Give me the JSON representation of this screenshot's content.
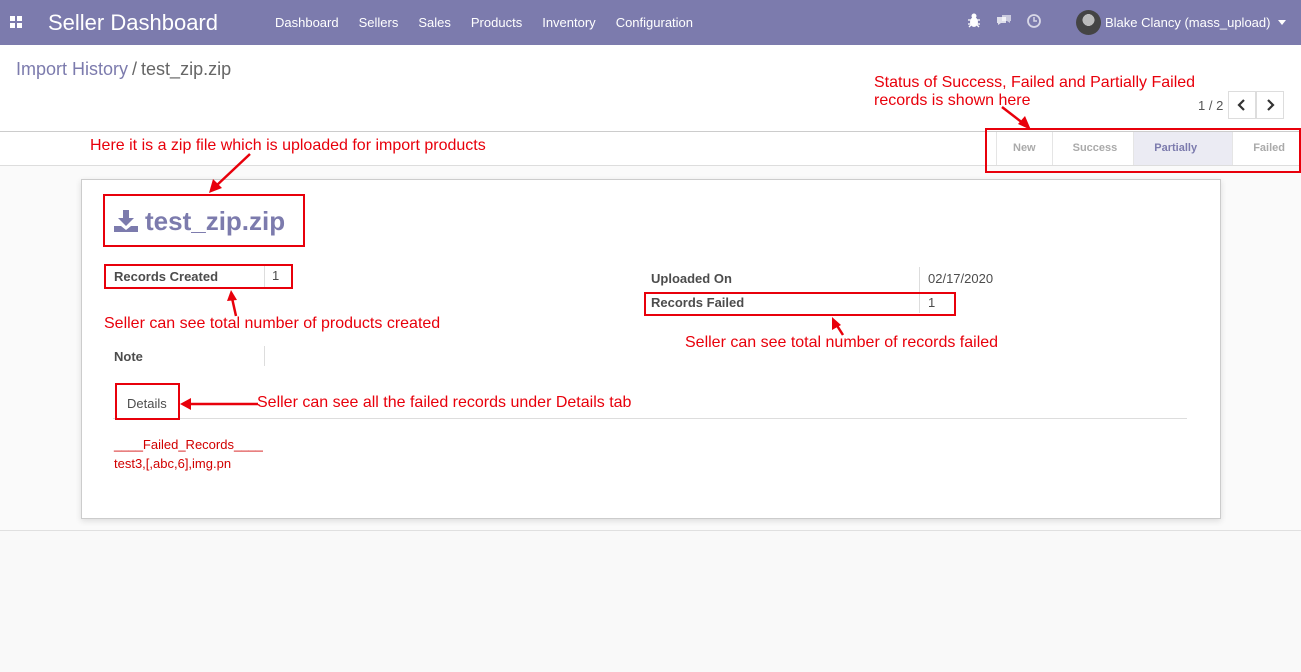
{
  "navbar": {
    "brand": "Seller Dashboard",
    "menu": [
      "Dashboard",
      "Sellers",
      "Sales",
      "Products",
      "Inventory",
      "Configuration"
    ],
    "icons": [
      "apps-icon",
      "bug-icon",
      "chat-icon",
      "clock-icon"
    ],
    "user": "Blake Clancy (mass_upload)"
  },
  "breadcrumb": {
    "parent": "Import History",
    "separator": "/",
    "current": "test_zip.zip"
  },
  "pager": {
    "value": "1 / 2"
  },
  "statusbar": {
    "stages": [
      "New",
      "Success",
      "Partially Failed",
      "Failed"
    ],
    "active": "Partially Failed"
  },
  "record": {
    "title": "test_zip.zip",
    "records_created_label": "Records Created",
    "records_created": "1",
    "uploaded_on_label": "Uploaded On",
    "uploaded_on": "02/17/2020",
    "records_failed_label": "Records Failed",
    "records_failed": "1",
    "note_label": "Note"
  },
  "tabs": {
    "details": "Details"
  },
  "details": {
    "header": "____Failed_Records____",
    "row": "test3,[,abc,6],img.pn"
  },
  "annotations": {
    "status": "Status of Success, Failed and Partially Failed",
    "status2": "records is shown here",
    "zip": "Here it is a zip file which is uploaded for import products",
    "created": "Seller can see total number of products created",
    "failed": "Seller can see total number of records failed",
    "details": "Seller can see all the failed records under Details tab"
  },
  "colors": {
    "primary": "#7c7bad",
    "annotation": "#e8000b",
    "failed_text": "#d10000"
  }
}
